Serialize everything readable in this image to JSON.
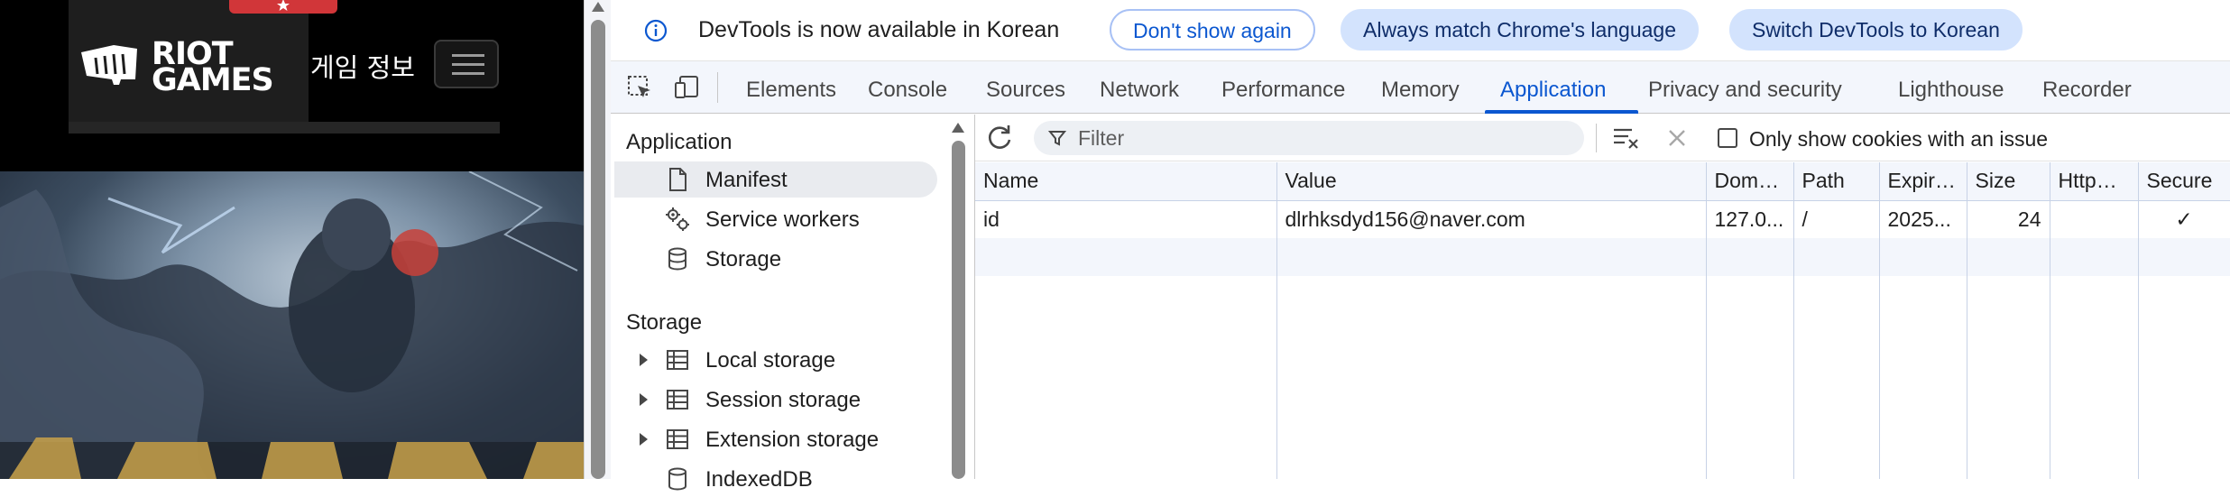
{
  "page": {
    "brand_name": "RIOT GAMES",
    "brand_line1": "RIOT",
    "brand_line2": "GAMES",
    "nav_label": "게임 정보"
  },
  "infobar": {
    "message": "DevTools is now available in Korean",
    "dont_show_again": "Don't show again",
    "always_match": "Always match Chrome's language",
    "switch_korean": "Switch DevTools to Korean"
  },
  "tabs": [
    {
      "label": "Elements",
      "active": false
    },
    {
      "label": "Console",
      "active": false
    },
    {
      "label": "Sources",
      "active": false
    },
    {
      "label": "Network",
      "active": false
    },
    {
      "label": "Performance",
      "active": false
    },
    {
      "label": "Memory",
      "active": false
    },
    {
      "label": "Application",
      "active": true
    },
    {
      "label": "Privacy and security",
      "active": false
    },
    {
      "label": "Lighthouse",
      "active": false
    },
    {
      "label": "Recorder",
      "active": false
    }
  ],
  "sidebar": {
    "application_heading": "Application",
    "application_items": [
      {
        "label": "Manifest",
        "icon": "document-icon",
        "selected": true
      },
      {
        "label": "Service workers",
        "icon": "gears-icon",
        "selected": false
      },
      {
        "label": "Storage",
        "icon": "database-icon",
        "selected": false
      }
    ],
    "storage_heading": "Storage",
    "storage_items": [
      {
        "label": "Local storage",
        "icon": "table-icon"
      },
      {
        "label": "Session storage",
        "icon": "table-icon"
      },
      {
        "label": "Extension storage",
        "icon": "table-icon"
      },
      {
        "label": "IndexedDB",
        "icon": "database-icon"
      }
    ]
  },
  "cookies": {
    "filter_placeholder": "Filter",
    "only_issue_label": "Only show cookies with an issue",
    "only_issue_checked": false,
    "columns": [
      "Name",
      "Value",
      "Domain",
      "Path",
      "Expires / Max-Age",
      "Size",
      "HttpOnly",
      "Secure"
    ],
    "rows": [
      {
        "name": "id",
        "value": "dlrhksdyd156@naver.com",
        "domain": "127.0...",
        "path": "/",
        "expires": "2025...",
        "size": "24",
        "httponly": "",
        "secure": "✓"
      }
    ]
  },
  "colors": {
    "accent": "#0b57d0",
    "pill_bg": "#d3e3fd",
    "riot_red": "#d13639"
  }
}
